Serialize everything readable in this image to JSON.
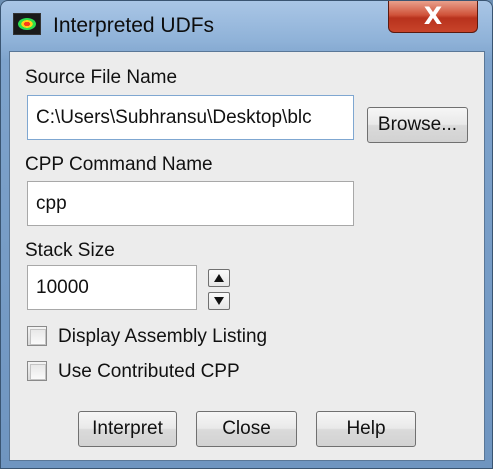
{
  "window": {
    "title": "Interpreted UDFs",
    "close_glyph": "X"
  },
  "source": {
    "label": "Source File Name",
    "value": "C:\\Users\\Subhransu\\Desktop\\blc",
    "browse_label": "Browse..."
  },
  "cpp": {
    "label": "CPP Command Name",
    "value": "cpp"
  },
  "stack": {
    "label": "Stack Size",
    "value": "10000"
  },
  "options": {
    "display_assembly": {
      "label": "Display Assembly Listing",
      "checked": false
    },
    "contributed_cpp": {
      "label": "Use Contributed CPP",
      "checked": false
    }
  },
  "buttons": {
    "interpret": "Interpret",
    "close": "Close",
    "help": "Help"
  },
  "icons": {
    "app": "fluent-app-icon",
    "up": "arrow-up-icon",
    "down": "arrow-down-icon"
  }
}
